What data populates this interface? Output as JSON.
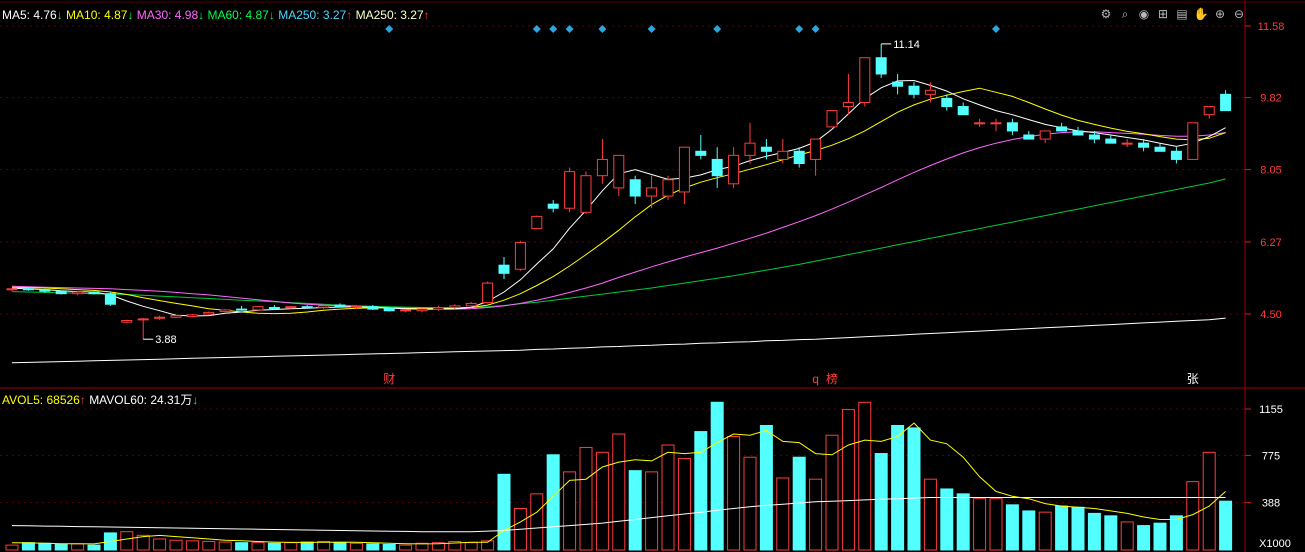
{
  "main_legend": [
    {
      "label": "MA5: 4.76",
      "arrow": "↓",
      "color": "#ffffff",
      "arrow_color": "#00ff4c"
    },
    {
      "label": "MA10: 4.87",
      "arrow": "↓",
      "color": "#ffff00",
      "arrow_color": "#00ff4c"
    },
    {
      "label": "MA30: 4.98",
      "arrow": "↓",
      "color": "#ff66ff",
      "arrow_color": "#00ff4c"
    },
    {
      "label": "MA60: 4.87",
      "arrow": "↓",
      "color": "#00ff4c",
      "arrow_color": "#00ff4c"
    },
    {
      "label": "MA250: 3.27",
      "arrow": "↑",
      "color": "#4fd6ff",
      "arrow_color": "#ff3c3c"
    },
    {
      "label": "MA250: 3.27",
      "arrow": "↑",
      "color": "#ffffcc",
      "arrow_color": "#ff3c3c"
    }
  ],
  "vol_legend": [
    {
      "label": "AVOL5: 68526",
      "arrow": "↑",
      "color": "#ffff00",
      "arrow_color": "#ff3c3c"
    },
    {
      "label": "MAVOL60: 24.31万",
      "arrow": "↓",
      "color": "#ffffff",
      "arrow_color": "#00ff4c"
    }
  ],
  "toolbar": {
    "icons": [
      {
        "name": "settings-icon",
        "glyph": "⚙"
      },
      {
        "name": "search-icon",
        "glyph": "⌕"
      },
      {
        "name": "eye-icon",
        "glyph": "◉"
      },
      {
        "name": "basket-icon",
        "glyph": "⊞"
      },
      {
        "name": "calendar-icon",
        "glyph": "▤"
      },
      {
        "name": "hand-icon",
        "glyph": "✋"
      },
      {
        "name": "zoom-in-icon",
        "glyph": "⊕"
      },
      {
        "name": "zoom-out-icon",
        "glyph": "⊖"
      }
    ]
  },
  "chart_data": [
    {
      "type": "candlestick",
      "price_axis_ticks": [
        "11.58",
        "9.82",
        "8.05",
        "6.27",
        "4.50"
      ],
      "price_tick_values": [
        11.58,
        9.82,
        8.05,
        6.27,
        4.5
      ],
      "high_label": "11.14",
      "high_value": 11.14,
      "low_label": "3.88",
      "low_value": 3.88,
      "event_markers": [
        {
          "label": "财",
          "color": "#ff3c3c"
        },
        {
          "label": "q",
          "color": "#ff3c3c"
        },
        {
          "label": "榜",
          "color": "#ff3c3c"
        },
        {
          "label": "张",
          "color": "#ffffff"
        }
      ],
      "candles_ohlc": [
        [
          5.1,
          5.14,
          5.06,
          5.12
        ],
        [
          5.12,
          5.14,
          5.07,
          5.1
        ],
        [
          5.1,
          5.12,
          5.02,
          5.06
        ],
        [
          5.06,
          5.08,
          4.98,
          5.0
        ],
        [
          5.0,
          5.06,
          4.96,
          5.04
        ],
        [
          5.04,
          5.06,
          4.98,
          5.0
        ],
        [
          5.0,
          5.04,
          4.7,
          4.74
        ],
        [
          4.3,
          4.36,
          4.28,
          4.34
        ],
        [
          4.36,
          4.4,
          3.88,
          4.38
        ],
        [
          4.4,
          4.46,
          4.36,
          4.42
        ],
        [
          4.42,
          4.48,
          4.4,
          4.46
        ],
        [
          4.44,
          4.5,
          4.42,
          4.48
        ],
        [
          4.5,
          4.56,
          4.48,
          4.54
        ],
        [
          4.56,
          4.62,
          4.54,
          4.6
        ],
        [
          4.62,
          4.7,
          4.58,
          4.6
        ],
        [
          4.6,
          4.7,
          4.58,
          4.68
        ],
        [
          4.66,
          4.72,
          4.6,
          4.64
        ],
        [
          4.66,
          4.7,
          4.62,
          4.68
        ],
        [
          4.68,
          4.72,
          4.64,
          4.66
        ],
        [
          4.66,
          4.72,
          4.62,
          4.7
        ],
        [
          4.72,
          4.76,
          4.66,
          4.68
        ],
        [
          4.68,
          4.72,
          4.62,
          4.7
        ],
        [
          4.68,
          4.72,
          4.6,
          4.62
        ],
        [
          4.64,
          4.66,
          4.56,
          4.58
        ],
        [
          4.58,
          4.62,
          4.54,
          4.6
        ],
        [
          4.58,
          4.64,
          4.54,
          4.62
        ],
        [
          4.62,
          4.7,
          4.58,
          4.66
        ],
        [
          4.66,
          4.74,
          4.62,
          4.7
        ],
        [
          4.7,
          4.8,
          4.66,
          4.76
        ],
        [
          4.78,
          5.3,
          4.76,
          5.26
        ],
        [
          5.7,
          5.9,
          5.36,
          5.5
        ],
        [
          5.6,
          6.3,
          5.56,
          6.26
        ],
        [
          6.6,
          6.92,
          6.6,
          6.9
        ],
        [
          7.2,
          7.3,
          7.0,
          7.1
        ],
        [
          7.1,
          8.1,
          7.0,
          8.0
        ],
        [
          7.0,
          8.0,
          6.96,
          7.9
        ],
        [
          7.9,
          8.8,
          7.7,
          8.3
        ],
        [
          7.6,
          8.4,
          7.4,
          8.4
        ],
        [
          7.8,
          7.9,
          7.2,
          7.4
        ],
        [
          7.4,
          7.9,
          7.1,
          7.6
        ],
        [
          7.4,
          7.9,
          7.3,
          7.8
        ],
        [
          7.5,
          8.6,
          7.2,
          8.6
        ],
        [
          8.5,
          8.9,
          8.3,
          8.4
        ],
        [
          8.3,
          8.6,
          7.6,
          7.9
        ],
        [
          7.7,
          8.6,
          7.6,
          8.4
        ],
        [
          8.4,
          9.2,
          8.2,
          8.7
        ],
        [
          8.6,
          8.8,
          8.3,
          8.5
        ],
        [
          8.3,
          8.8,
          8.2,
          8.5
        ],
        [
          8.5,
          8.6,
          8.1,
          8.2
        ],
        [
          8.3,
          8.8,
          7.9,
          8.8
        ],
        [
          9.1,
          9.5,
          9.1,
          9.5
        ],
        [
          9.6,
          10.4,
          9.4,
          9.7
        ],
        [
          9.7,
          10.8,
          9.6,
          10.8
        ],
        [
          10.8,
          11.14,
          10.3,
          10.4
        ],
        [
          10.2,
          10.4,
          9.9,
          10.1
        ],
        [
          10.1,
          10.2,
          9.8,
          9.9
        ],
        [
          9.9,
          10.2,
          9.7,
          10.0
        ],
        [
          9.8,
          9.9,
          9.5,
          9.6
        ],
        [
          9.6,
          9.7,
          9.4,
          9.4
        ],
        [
          9.2,
          9.3,
          9.1,
          9.2
        ],
        [
          9.2,
          9.3,
          9.0,
          9.2
        ],
        [
          9.2,
          9.3,
          8.9,
          9.0
        ],
        [
          8.9,
          9.0,
          8.8,
          8.8
        ],
        [
          8.8,
          9.0,
          8.7,
          9.0
        ],
        [
          9.1,
          9.2,
          9.0,
          9.0
        ],
        [
          9.0,
          9.1,
          8.9,
          8.9
        ],
        [
          8.9,
          9.0,
          8.7,
          8.8
        ],
        [
          8.8,
          8.9,
          8.7,
          8.7
        ],
        [
          8.7,
          8.8,
          8.6,
          8.7
        ],
        [
          8.7,
          8.8,
          8.5,
          8.6
        ],
        [
          8.6,
          8.7,
          8.5,
          8.5
        ],
        [
          8.5,
          8.6,
          8.2,
          8.3
        ],
        [
          8.3,
          9.2,
          8.3,
          9.2
        ],
        [
          9.4,
          9.6,
          9.3,
          9.6
        ],
        [
          9.9,
          10.0,
          9.5,
          9.5
        ]
      ],
      "ma5_values": [
        5.13,
        5.12,
        5.1,
        5.07,
        5.05,
        5.04,
        4.97,
        4.82,
        4.69,
        4.58,
        4.47,
        4.45,
        4.46,
        4.52,
        4.55,
        4.59,
        4.61,
        4.63,
        4.64,
        4.66,
        4.67,
        4.68,
        4.67,
        4.65,
        4.63,
        4.62,
        4.62,
        4.63,
        4.66,
        4.81,
        5.04,
        5.34,
        5.73,
        6.1,
        6.61,
        7.05,
        7.53,
        7.95,
        8.05,
        7.93,
        7.81,
        7.84,
        7.92,
        8.05,
        8.13,
        8.27,
        8.38,
        8.47,
        8.57,
        8.73,
        9.04,
        9.42,
        9.8,
        10.06,
        10.23,
        10.24,
        10.12,
        9.98,
        9.79,
        9.64,
        9.5,
        9.4,
        9.28,
        9.16,
        9.08,
        9.0,
        8.96,
        8.9,
        8.84,
        8.78,
        8.7,
        8.62,
        8.7,
        8.86,
        9.08
      ],
      "ma10_values": [
        5.16,
        5.15,
        5.14,
        5.12,
        5.1,
        5.08,
        5.04,
        4.98,
        4.9,
        4.83,
        4.76,
        4.7,
        4.63,
        4.59,
        4.55,
        4.52,
        4.51,
        4.52,
        4.55,
        4.59,
        4.62,
        4.64,
        4.65,
        4.65,
        4.64,
        4.64,
        4.64,
        4.65,
        4.66,
        4.72,
        4.84,
        5.0,
        5.2,
        5.42,
        5.68,
        5.96,
        6.25,
        6.56,
        6.89,
        7.19,
        7.42,
        7.6,
        7.74,
        7.85,
        7.95,
        8.06,
        8.17,
        8.29,
        8.41,
        8.52,
        8.65,
        8.81,
        9.0,
        9.23,
        9.46,
        9.64,
        9.78,
        9.88,
        9.97,
        10.05,
        9.95,
        9.85,
        9.7,
        9.54,
        9.39,
        9.26,
        9.16,
        9.07,
        8.99,
        8.93,
        8.86,
        8.8,
        8.78,
        8.82,
        8.96
      ],
      "ma30_values": [
        5.18,
        5.17,
        5.16,
        5.15,
        5.14,
        5.13,
        5.12,
        5.1,
        5.08,
        5.06,
        5.03,
        5.0,
        4.97,
        4.93,
        4.89,
        4.85,
        4.81,
        4.77,
        4.74,
        4.72,
        4.7,
        4.68,
        4.66,
        4.64,
        4.63,
        4.62,
        4.62,
        4.62,
        4.63,
        4.66,
        4.7,
        4.76,
        4.84,
        4.93,
        5.03,
        5.14,
        5.26,
        5.4,
        5.53,
        5.66,
        5.78,
        5.9,
        6.01,
        6.12,
        6.24,
        6.36,
        6.49,
        6.63,
        6.77,
        6.92,
        7.08,
        7.25,
        7.43,
        7.61,
        7.8,
        7.98,
        8.15,
        8.31,
        8.46,
        8.59,
        8.7,
        8.79,
        8.86,
        8.92,
        8.96,
        8.98,
        8.98,
        8.96,
        8.94,
        8.92,
        8.89,
        8.87,
        8.87,
        8.9,
        8.96
      ],
      "ma60_values": [
        5.05,
        5.04,
        5.03,
        5.02,
        5.01,
        5.0,
        4.99,
        4.98,
        4.96,
        4.94,
        4.92,
        4.9,
        4.88,
        4.86,
        4.84,
        4.82,
        4.8,
        4.78,
        4.76,
        4.74,
        4.72,
        4.7,
        4.69,
        4.68,
        4.67,
        4.66,
        4.65,
        4.65,
        4.66,
        4.68,
        4.71,
        4.75,
        4.79,
        4.84,
        4.89,
        4.94,
        4.99,
        5.04,
        5.09,
        5.14,
        5.2,
        5.26,
        5.32,
        5.38,
        5.44,
        5.51,
        5.58,
        5.65,
        5.72,
        5.8,
        5.88,
        5.96,
        6.04,
        6.12,
        6.2,
        6.28,
        6.36,
        6.44,
        6.52,
        6.6,
        6.68,
        6.76,
        6.84,
        6.92,
        7.0,
        7.08,
        7.16,
        7.24,
        7.32,
        7.4,
        7.48,
        7.56,
        7.64,
        7.72,
        7.82
      ],
      "ma250_values": [
        3.3,
        3.31,
        3.32,
        3.33,
        3.34,
        3.35,
        3.36,
        3.37,
        3.38,
        3.39,
        3.4,
        3.41,
        3.42,
        3.43,
        3.44,
        3.45,
        3.46,
        3.47,
        3.48,
        3.49,
        3.5,
        3.51,
        3.52,
        3.53,
        3.54,
        3.55,
        3.56,
        3.57,
        3.58,
        3.59,
        3.6,
        3.61,
        3.63,
        3.64,
        3.66,
        3.67,
        3.69,
        3.7,
        3.72,
        3.73,
        3.75,
        3.76,
        3.78,
        3.79,
        3.81,
        3.82,
        3.84,
        3.85,
        3.87,
        3.88,
        3.9,
        3.92,
        3.94,
        3.96,
        3.98,
        4.0,
        4.02,
        4.04,
        4.06,
        4.08,
        4.1,
        4.12,
        4.14,
        4.16,
        4.18,
        4.2,
        4.22,
        4.24,
        4.26,
        4.28,
        4.3,
        4.32,
        4.34,
        4.36,
        4.4
      ]
    },
    {
      "type": "bar",
      "volume_axis_ticks": [
        "1155",
        "775",
        "388",
        "X1000"
      ],
      "volume_tick_values": [
        1155,
        775,
        388
      ],
      "volume_unit": "X1000",
      "volumes": [
        40,
        60,
        55,
        45,
        50,
        40,
        140,
        150,
        120,
        90,
        80,
        75,
        70,
        65,
        60,
        60,
        55,
        60,
        65,
        70,
        60,
        55,
        50,
        45,
        40,
        55,
        60,
        70,
        60,
        75,
        620,
        340,
        460,
        780,
        640,
        840,
        800,
        950,
        650,
        640,
        860,
        750,
        970,
        1210,
        930,
        760,
        1020,
        590,
        760,
        580,
        940,
        1150,
        1210,
        790,
        1020,
        1000,
        580,
        500,
        460,
        420,
        420,
        370,
        320,
        310,
        360,
        350,
        300,
        280,
        230,
        200,
        220,
        280,
        560,
        800,
        400
      ],
      "avol5_values": [
        60,
        58,
        55,
        52,
        52,
        50,
        70,
        90,
        110,
        120,
        110,
        100,
        90,
        80,
        75,
        70,
        65,
        62,
        62,
        63,
        65,
        63,
        60,
        55,
        52,
        50,
        52,
        57,
        63,
        63,
        160,
        230,
        310,
        440,
        570,
        580,
        680,
        720,
        740,
        730,
        800,
        790,
        800,
        880,
        950,
        940,
        980,
        890,
        880,
        790,
        780,
        860,
        900,
        890,
        930,
        1040,
        900,
        870,
        760,
        600,
        480,
        440,
        420,
        380,
        360,
        350,
        340,
        320,
        300,
        270,
        250,
        250,
        290,
        360,
        480
      ],
      "mavol60_values": [
        200,
        198,
        196,
        194,
        192,
        190,
        188,
        186,
        184,
        182,
        180,
        178,
        176,
        174,
        172,
        170,
        168,
        166,
        164,
        162,
        160,
        158,
        156,
        154,
        152,
        150,
        150,
        150,
        150,
        155,
        160,
        170,
        180,
        190,
        200,
        210,
        220,
        235,
        250,
        265,
        280,
        295,
        310,
        325,
        340,
        355,
        365,
        375,
        385,
        395,
        400,
        405,
        410,
        415,
        420,
        425,
        430,
        430,
        430,
        430,
        430,
        430,
        430,
        430,
        430,
        430,
        430,
        430,
        430,
        430,
        430,
        430,
        430,
        430,
        430
      ],
      "x_marker_label": "X1000"
    }
  ]
}
